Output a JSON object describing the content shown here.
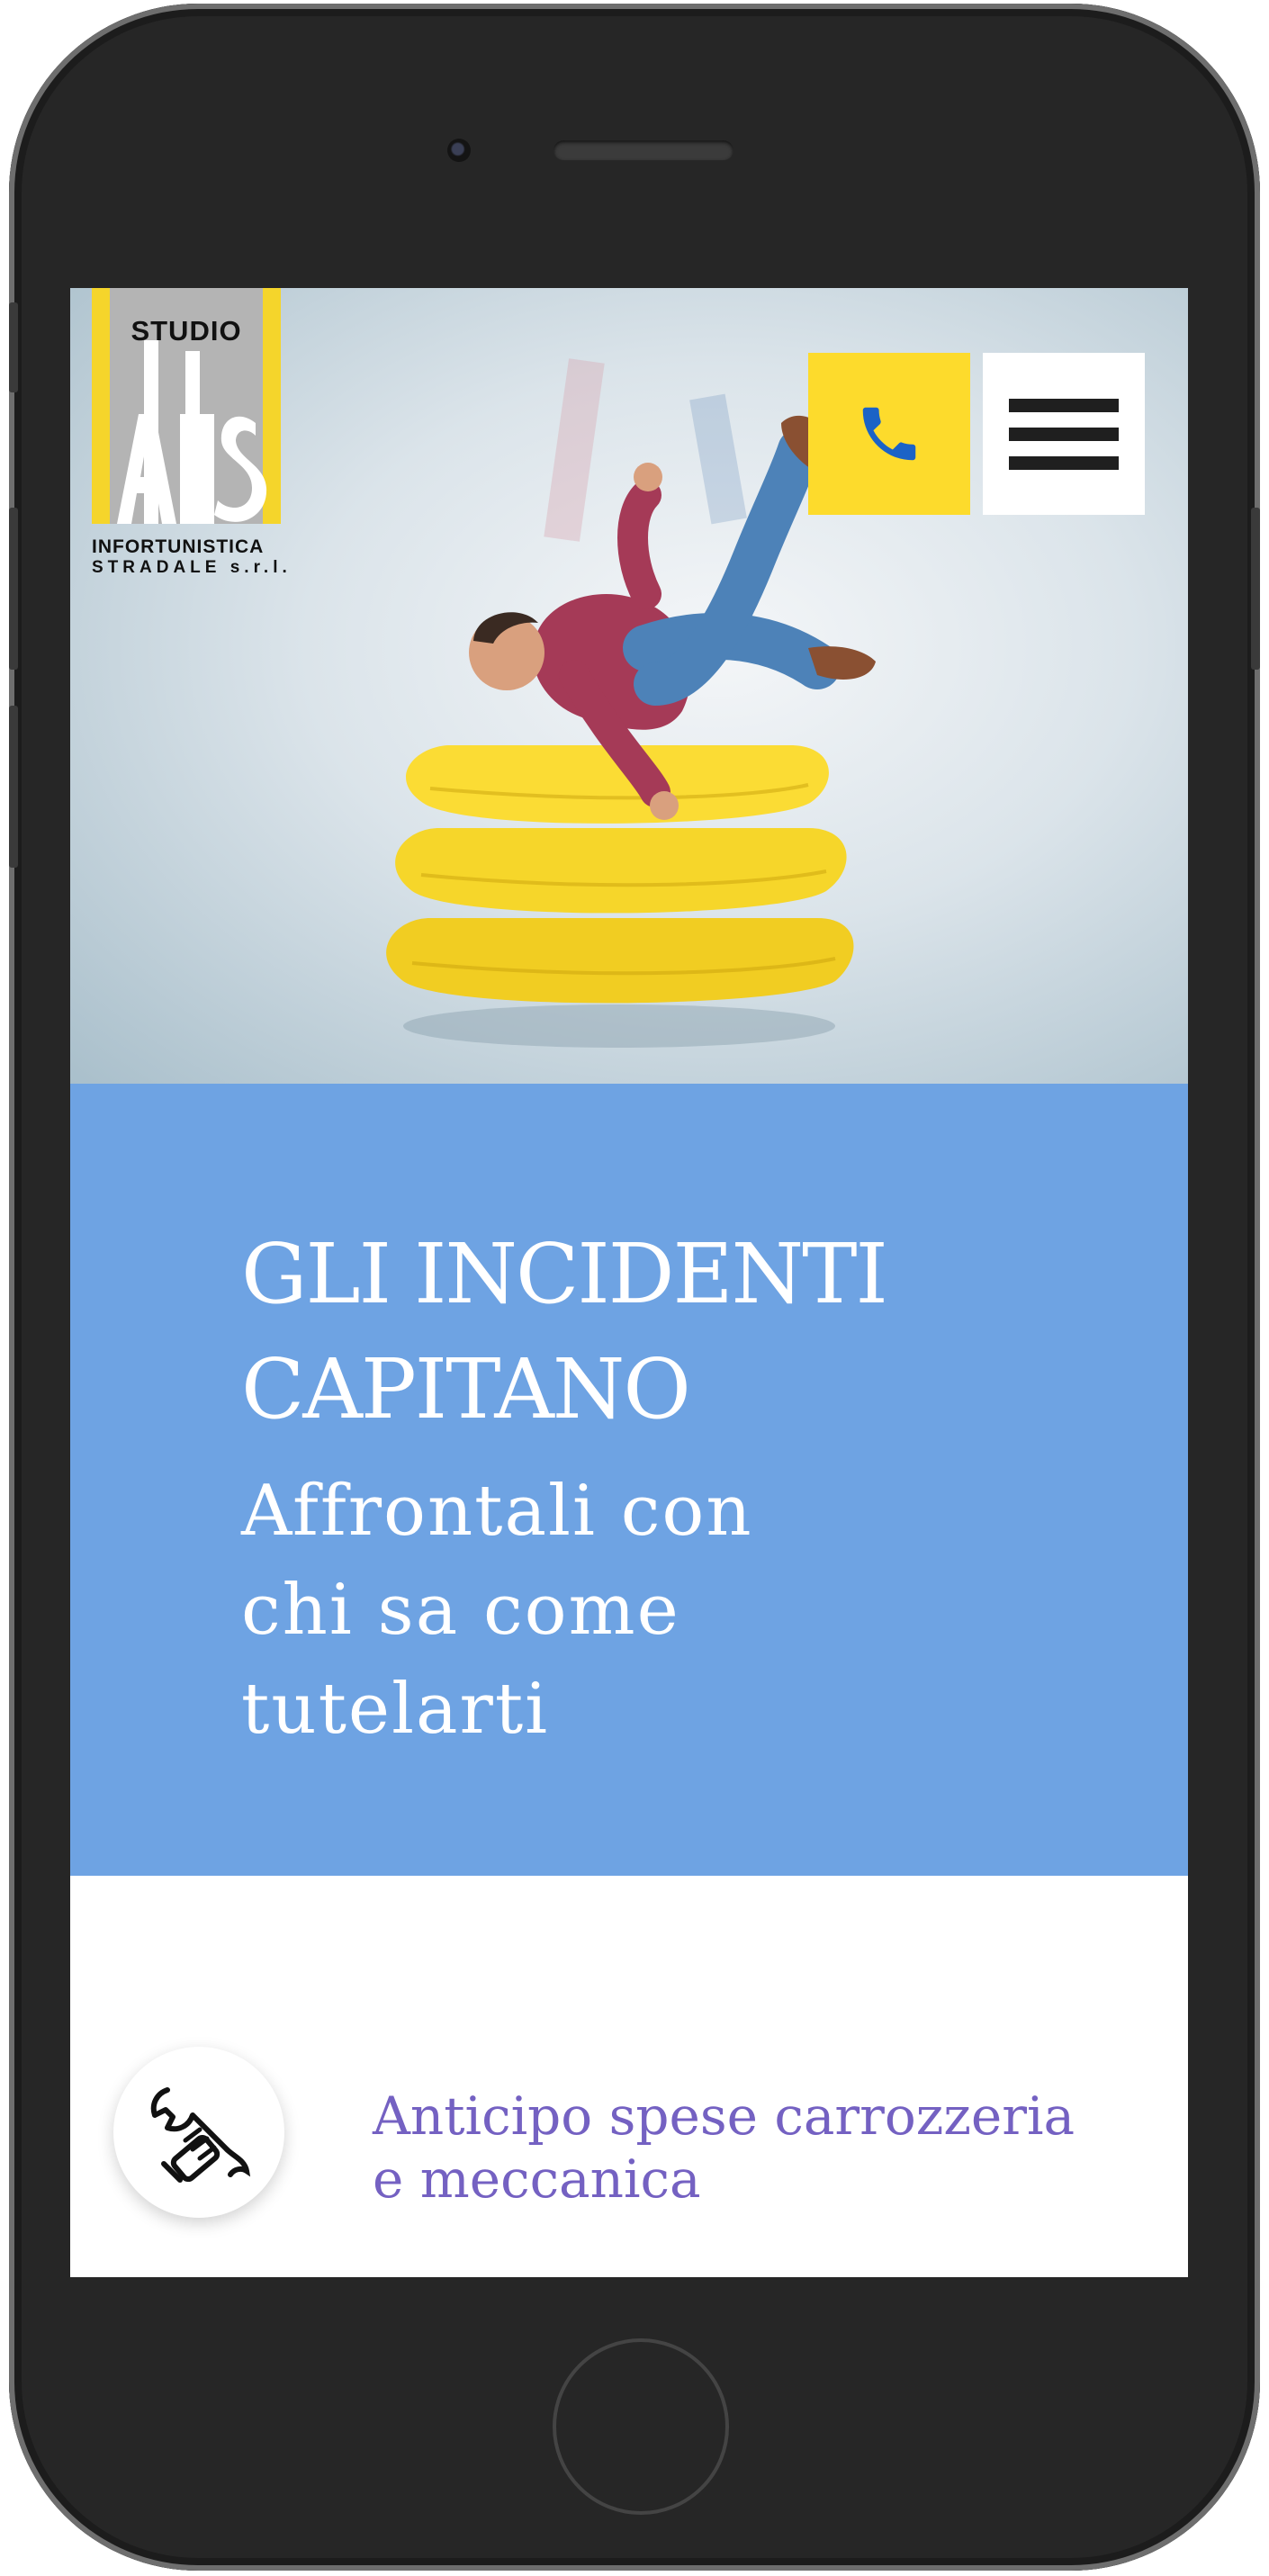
{
  "brand": {
    "logo_word": "STUDIO",
    "logo_mark": "AlliS",
    "logo_line1": "INFORTUNISTICA",
    "logo_line2": "STRADALE s.r.l."
  },
  "header": {
    "call_icon": "phone-icon",
    "menu_icon": "hamburger-menu-icon"
  },
  "hero": {
    "image": "man-falling-on-yellow-pillows"
  },
  "banner": {
    "headline": "GLI INCIDENTI\nCAPITANO",
    "subheadline": "Affrontali con\nchi sa come\ntutelarti"
  },
  "services": [
    {
      "icon": "wrench-hand-icon",
      "label": "Anticipo spese carrozzeria\ne meccanica"
    }
  ],
  "colors": {
    "accent_yellow": "#fddb2c",
    "banner_blue": "#6ea3e3",
    "service_purple": "#7461c2",
    "phone_icon_blue": "#1b63c6"
  }
}
